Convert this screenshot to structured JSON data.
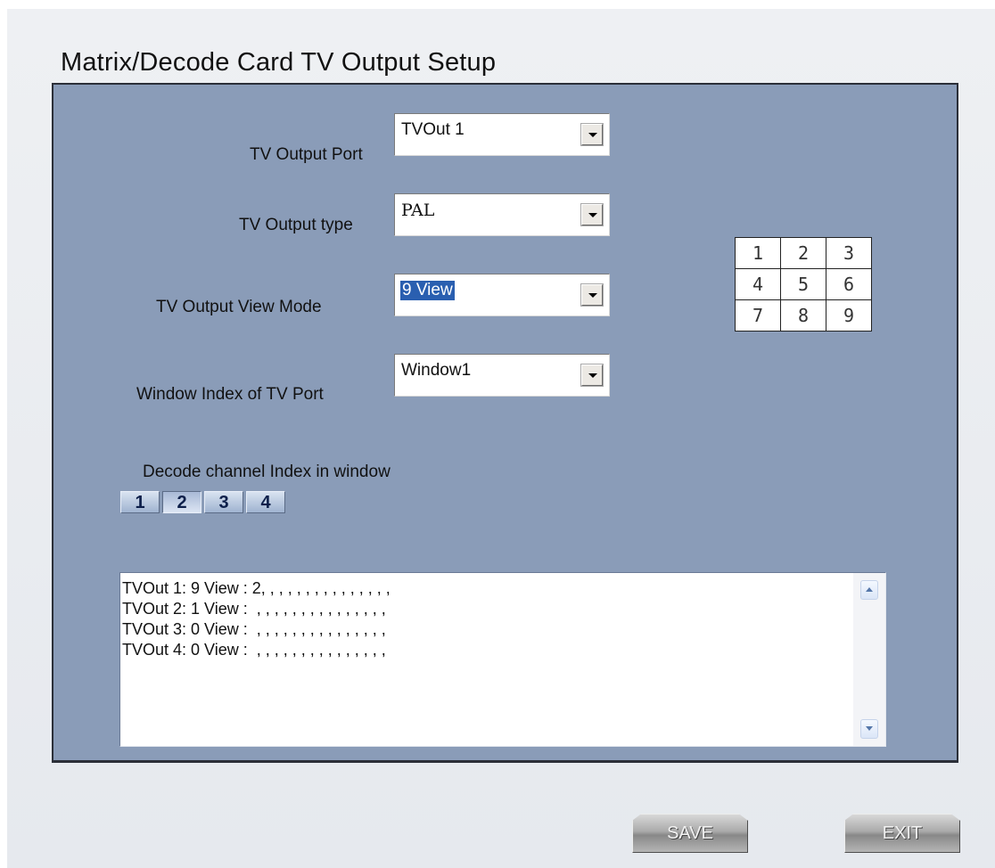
{
  "window": {
    "title": "Matrix/Decode Card TV Output Setup"
  },
  "form": {
    "tv_output_port": {
      "label": "TV Output Port",
      "value": "TVOut 1"
    },
    "tv_output_type": {
      "label": "TV Output  type",
      "value": "PAL"
    },
    "tv_output_view_mode": {
      "label": "TV Output View  Mode",
      "value": "9 View"
    },
    "window_index": {
      "label": "Window Index of TV Port",
      "value": "Window1"
    }
  },
  "view_grid": {
    "cells": [
      "1",
      "2",
      "3",
      "4",
      "5",
      "6",
      "7",
      "8",
      "9"
    ]
  },
  "decode_channel": {
    "label": "Decode channel Index in window",
    "buttons": [
      "1",
      "2",
      "3",
      "4"
    ],
    "selected": "2"
  },
  "output_list": {
    "lines": [
      "TVOut 1: 9 View : 2, , , , , , , , , , , , , , ,",
      "TVOut 2: 1 View :  , , , , , , , , , , , , , , ,",
      "TVOut 3: 0 View :  , , , , , , , , , , , , , , ,",
      "TVOut 4: 0 View :  , , , , , , , , , , , , , , ,"
    ]
  },
  "footer": {
    "save_label": "SAVE",
    "exit_label": "EXIT"
  },
  "colors": {
    "panel_bg": "#8a9cb8",
    "selection": "#2a5fb0"
  },
  "icons": {
    "combo_arrow": "chevron-down-icon",
    "scroll_up": "scroll-up-icon",
    "scroll_down": "scroll-down-icon"
  }
}
